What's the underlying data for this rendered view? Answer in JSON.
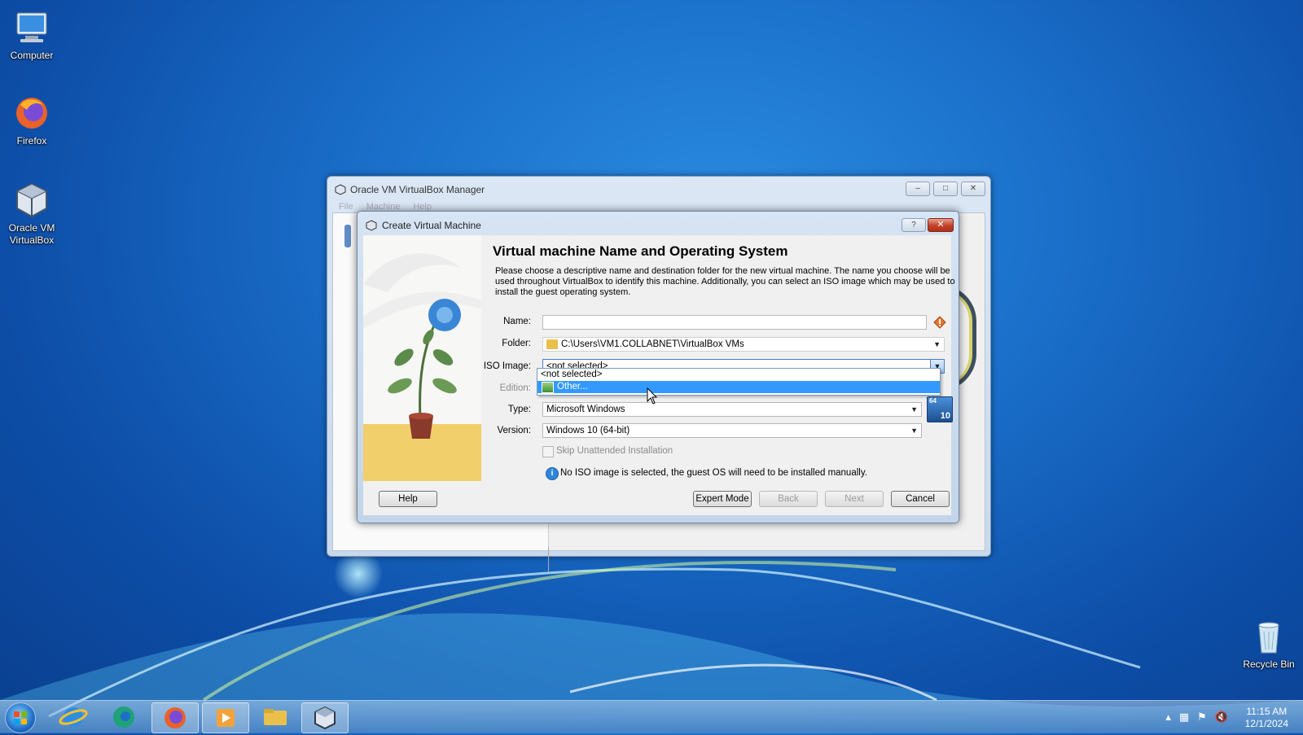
{
  "desktop": {
    "icons": [
      {
        "label": "Computer",
        "icon": "computer-icon"
      },
      {
        "label": "Firefox",
        "icon": "firefox-icon"
      },
      {
        "label": "Oracle VM VirtualBox",
        "icon": "virtualbox-icon"
      },
      {
        "label": "Recycle Bin",
        "icon": "recycle-bin-icon"
      }
    ]
  },
  "manager": {
    "title": "Oracle VM VirtualBox Manager",
    "menu": [
      "File",
      "Machine",
      "Help"
    ],
    "buttons": {
      "minimize": "–",
      "maximize": "□",
      "close": "✕"
    }
  },
  "dialog": {
    "title": "Create Virtual Machine",
    "help_btn": "?",
    "close_btn": "✕",
    "heading": "Virtual machine Name and Operating System",
    "description": "Please choose a descriptive name and destination folder for the new virtual machine. The name you choose will be used throughout VirtualBox to identify this machine. Additionally, you can select an ISO image which may be used to install the guest operating system.",
    "fields": {
      "name_label": "Name:",
      "name_value": "",
      "folder_label": "Folder:",
      "folder_value": "C:\\Users\\VM1.COLLABNET\\VirtualBox VMs",
      "iso_label": "ISO Image:",
      "iso_value": "<not selected>",
      "edition_label": "Edition:",
      "type_label": "Type:",
      "type_value": "Microsoft Windows",
      "version_label": "Version:",
      "version_value": "Windows 10 (64-bit)",
      "os_badge": "10",
      "os_badge_top": "64"
    },
    "iso_dropdown": {
      "options": [
        "<not selected>",
        "Other..."
      ],
      "highlighted": "Other..."
    },
    "skip_unattended": {
      "label": "Skip Unattended Installation",
      "checked": false
    },
    "info_text": "No ISO image is selected, the guest OS will need to be installed manually.",
    "buttons": {
      "help": "Help",
      "expert": "Expert Mode",
      "back": "Back",
      "next": "Next",
      "cancel": "Cancel"
    }
  },
  "taskbar": {
    "items": [
      "start-button",
      "internet-explorer-icon",
      "edge-icon",
      "firefox-icon",
      "media-player-icon",
      "file-explorer-icon",
      "virtualbox-icon"
    ],
    "clock_time": "11:15 AM",
    "clock_date": "12/1/2024"
  },
  "colors": {
    "selection": "#3399ff",
    "desktop": "#1a6fc9",
    "warning": "#e8742a"
  }
}
